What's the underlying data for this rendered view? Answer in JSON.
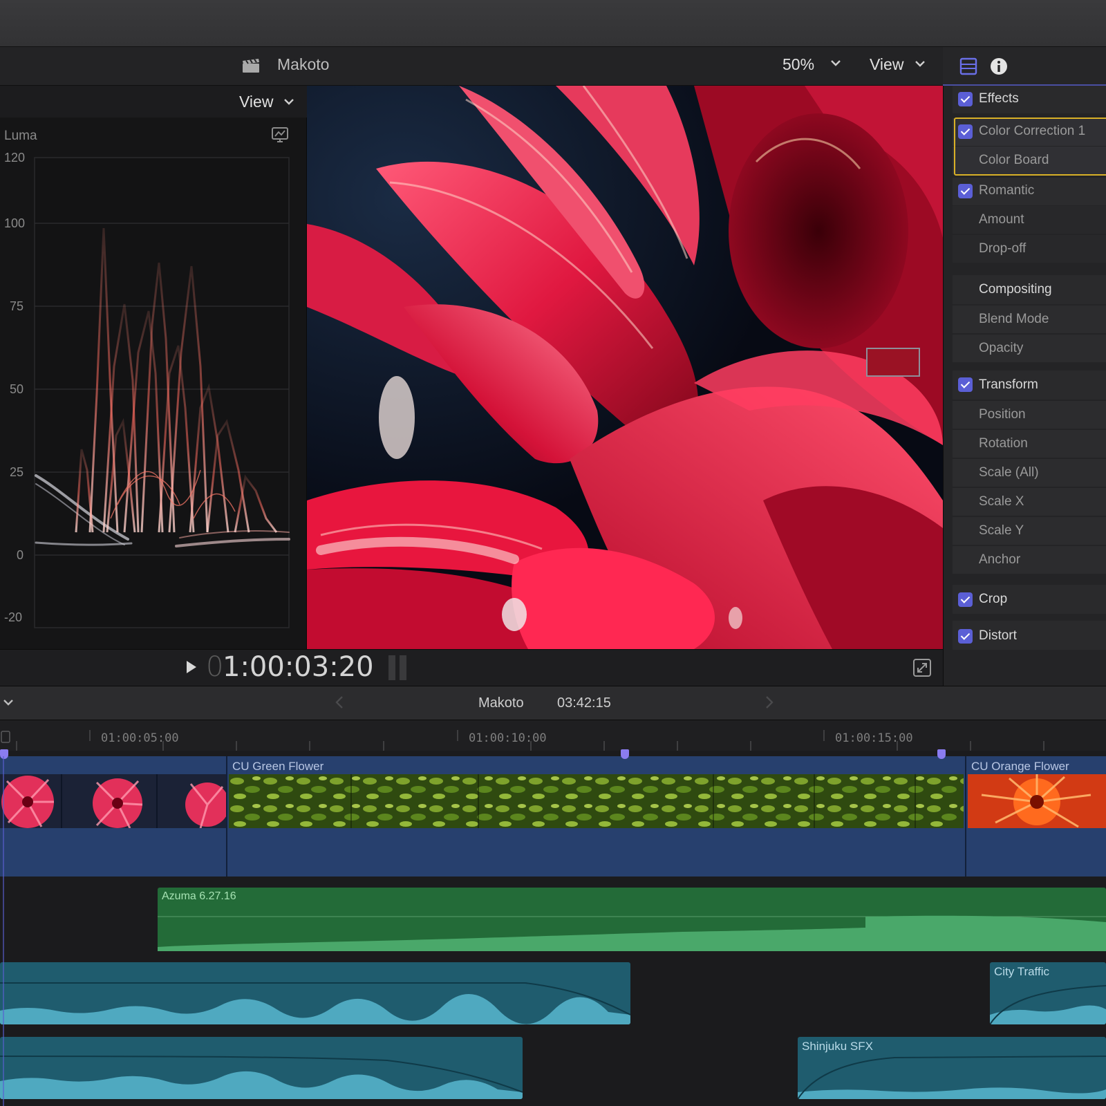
{
  "viewer": {
    "project_name": "Makoto",
    "zoom": "50%",
    "view_menu": "View"
  },
  "scope": {
    "view_menu": "View",
    "mode": "Luma",
    "scale_labels": [
      "120",
      "100",
      "75",
      "50",
      "25",
      "0",
      "-20"
    ]
  },
  "inspector": {
    "effects_label": "Effects",
    "color_correction_label": "Color Correction 1",
    "color_board_label": "Color Board",
    "romantic_label": "Romantic",
    "amount_label": "Amount",
    "dropoff_label": "Drop-off",
    "compositing_label": "Compositing",
    "blend_mode_label": "Blend Mode",
    "opacity_label": "Opacity",
    "transform_label": "Transform",
    "position_label": "Position",
    "rotation_label": "Rotation",
    "scale_all_label": "Scale (All)",
    "scale_x_label": "Scale X",
    "scale_y_label": "Scale Y",
    "anchor_label": "Anchor",
    "crop_label": "Crop",
    "distort_label": "Distort"
  },
  "transport": {
    "timecode_lead": "0",
    "timecode": "1:00:03:20"
  },
  "timeline": {
    "project_name": "Makoto",
    "duration": "03:42:15",
    "ruler_labels": [
      "01:00:05:00",
      "01:00:10:00",
      "01:00:15:00"
    ],
    "clips": {
      "green": "CU Green Flower",
      "orange": "CU Orange Flower"
    },
    "music": "Azuma 6.27.16",
    "sfx": {
      "city": "City Traffic",
      "shinjuku": "Shinjuku SFX"
    }
  },
  "colors": {
    "accent": "#5b5fd6",
    "storyline": "#27406e",
    "music": "#236b38",
    "sfx": "#1f5c6e",
    "selection": "#d9b127"
  },
  "icons": [
    "clapper-icon",
    "chevron-down-icon",
    "scope-settings-icon",
    "video-inspector-icon",
    "info-icon",
    "play-icon",
    "fullscreen-icon",
    "back-arrow-icon",
    "forward-arrow-icon",
    "checkbox-icon",
    "marker-icon"
  ]
}
